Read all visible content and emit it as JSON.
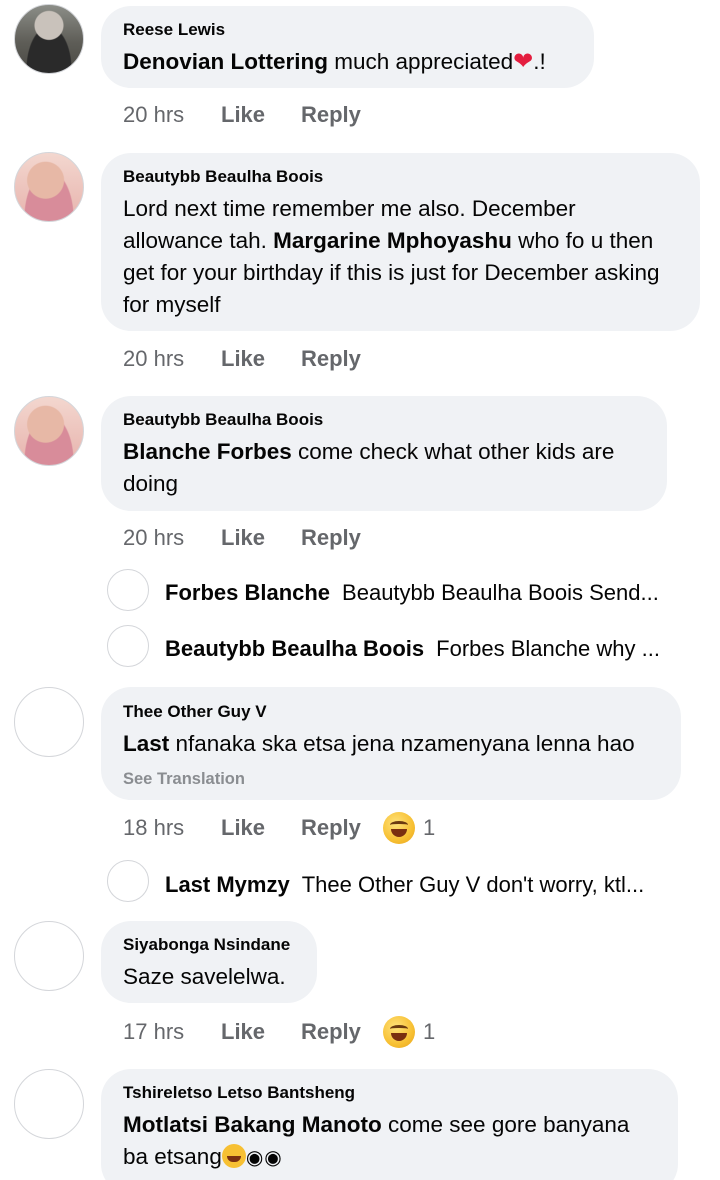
{
  "comments": [
    {
      "author": "Reese Lewis",
      "mention": "Denovian Lottering",
      "text": " much appreciated",
      "emoji_suffix": "❤️",
      "tail": ".!",
      "time": "20 hrs",
      "like": "Like",
      "reply": "Reply"
    },
    {
      "author": "Beautybb Beaulha Boois",
      "text_before": "Lord next time remember me also. December allowance tah. ",
      "mention": "Margarine Mphoyashu",
      "text_after": "  who fo u then get for your birthday if this is just for December asking for myself",
      "time": "20 hrs",
      "like": "Like",
      "reply": "Reply"
    },
    {
      "author": "Beautybb Beaulha Boois",
      "mention": "Blanche Forbes",
      "text": "  come check what other kids are doing",
      "time": "20 hrs",
      "like": "Like",
      "reply": "Reply",
      "replies": [
        {
          "name": "Forbes Blanche",
          "text": "Beautybb Beaulha Boois Send..."
        },
        {
          "name": "Beautybb Beaulha Boois",
          "text": "Forbes Blanche why ..."
        }
      ]
    },
    {
      "author": "Thee Other Guy V",
      "mention": "Last",
      "text": " nfanaka ska etsa jena nzamenyana lenna hao",
      "see_translation": "See Translation",
      "time": "18 hrs",
      "like": "Like",
      "reply": "Reply",
      "reaction_icon": "laughing-icon",
      "reaction_count": "1",
      "replies": [
        {
          "name": "Last Mymzy",
          "text": "Thee Other Guy V don't worry, ktl..."
        }
      ]
    },
    {
      "author": "Siyabonga Nsindane",
      "text": "Saze savelelwa.",
      "time": "17 hrs",
      "like": "Like",
      "reply": "Reply",
      "reaction_icon": "laughing-icon",
      "reaction_count": "1"
    },
    {
      "author": "Tshireletso Letso Bantsheng",
      "mention": "Motlatsi Bakang Manoto",
      "text": "  come see gore banyana ba etsang",
      "emoji_suffix": "🤣👀"
    }
  ]
}
